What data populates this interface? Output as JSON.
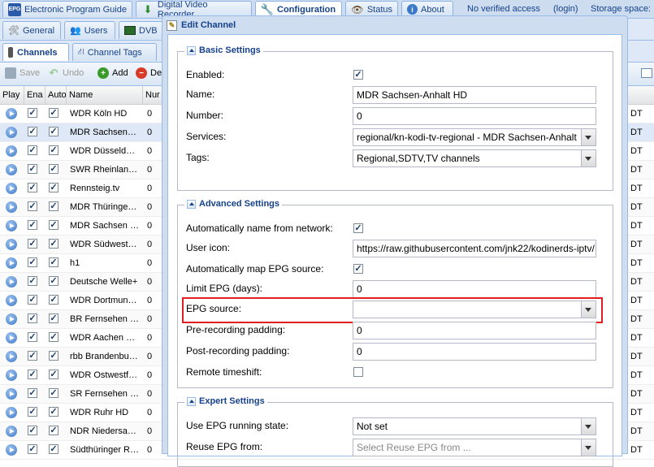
{
  "top_tabs": [
    {
      "label": "Electronic Program Guide",
      "icon": "epg-icon"
    },
    {
      "label": "Digital Video Recorder",
      "icon": "download-icon"
    },
    {
      "label": "Configuration",
      "icon": "wrench-icon",
      "active": true
    },
    {
      "label": "Status",
      "icon": "eye-icon"
    },
    {
      "label": "About",
      "icon": "info-icon"
    }
  ],
  "status": {
    "access": "No verified access",
    "login": "(login)",
    "storage": "Storage space:"
  },
  "config_tabs": [
    {
      "label": "General",
      "icon": "tools-icon"
    },
    {
      "label": "Users",
      "icon": "users-icon"
    },
    {
      "label": "DVB",
      "icon": "dvb-icon"
    }
  ],
  "dvb_tabs": [
    {
      "label": "Channels",
      "icon": "remote-icon",
      "active": true
    },
    {
      "label": "Channel Tags",
      "icon": "tags-icon"
    }
  ],
  "toolbar": {
    "save": "Save",
    "undo": "Undo",
    "add": "Add",
    "delete": "De"
  },
  "grid": {
    "headers": {
      "play": "Play",
      "enabled": "Ena",
      "auto": "Auto",
      "name": "Name",
      "number": "Nur"
    },
    "rows": [
      {
        "name": "WDR Köln HD",
        "number": "0",
        "extra": "DT"
      },
      {
        "name": "MDR Sachsen…",
        "number": "0",
        "extra": "DT"
      },
      {
        "name": "WDR Düsseld…",
        "number": "0",
        "extra": "DT"
      },
      {
        "name": "SWR Rheinlan…",
        "number": "0",
        "extra": "DT"
      },
      {
        "name": "Rennsteig.tv",
        "number": "0",
        "extra": "DT"
      },
      {
        "name": "MDR Thüringe…",
        "number": "0",
        "extra": "DT"
      },
      {
        "name": "MDR Sachsen …",
        "number": "0",
        "extra": "DT"
      },
      {
        "name": "WDR Südwest…",
        "number": "0",
        "extra": "DT"
      },
      {
        "name": "h1",
        "number": "0",
        "extra": "DT"
      },
      {
        "name": "Deutsche Welle+",
        "number": "0",
        "extra": "DT"
      },
      {
        "name": "WDR Dortmun…",
        "number": "0",
        "extra": "DT"
      },
      {
        "name": "BR Fernsehen …",
        "number": "0",
        "extra": "DT"
      },
      {
        "name": "WDR Aachen …",
        "number": "0",
        "extra": "DT"
      },
      {
        "name": "rbb Brandenbu…",
        "number": "0",
        "extra": "DT"
      },
      {
        "name": "WDR Ostwestf…",
        "number": "0",
        "extra": "DT"
      },
      {
        "name": "SR Fernsehen …",
        "number": "0",
        "extra": "DT"
      },
      {
        "name": "WDR Ruhr HD",
        "number": "0",
        "extra": "DT"
      },
      {
        "name": "NDR Niedersa…",
        "number": "0",
        "extra": "DT"
      },
      {
        "name": "Südthüringer R…",
        "number": "0",
        "extra": "DT"
      }
    ]
  },
  "dialog": {
    "title": "Edit Channel",
    "basic": {
      "legend": "Basic Settings",
      "enabled_label": "Enabled:",
      "name_label": "Name:",
      "name_value": "MDR Sachsen-Anhalt HD",
      "number_label": "Number:",
      "number_value": "0",
      "services_label": "Services:",
      "services_value": "regional/kn-kodi-tv-regional - MDR Sachsen-Anhalt",
      "tags_label": "Tags:",
      "tags_value": "Regional,SDTV,TV channels"
    },
    "advanced": {
      "legend": "Advanced Settings",
      "autoname_label": "Automatically name from network:",
      "icon_label": "User icon:",
      "icon_value": "https://raw.githubusercontent.com/jnk22/kodinerds-iptv/",
      "automap_label": "Automatically map EPG source:",
      "limit_label": "Limit EPG (days):",
      "limit_value": "0",
      "epgsrc_label": "EPG source:",
      "epgsrc_value": "",
      "prepad_label": "Pre-recording padding:",
      "prepad_value": "0",
      "postpad_label": "Post-recording padding:",
      "postpad_value": "0",
      "timeshift_label": "Remote timeshift:"
    },
    "expert": {
      "legend": "Expert Settings",
      "running_label": "Use EPG running state:",
      "running_value": "Not set",
      "reuse_label": "Reuse EPG from:",
      "reuse_placeholder": "Select Reuse EPG from ..."
    }
  }
}
